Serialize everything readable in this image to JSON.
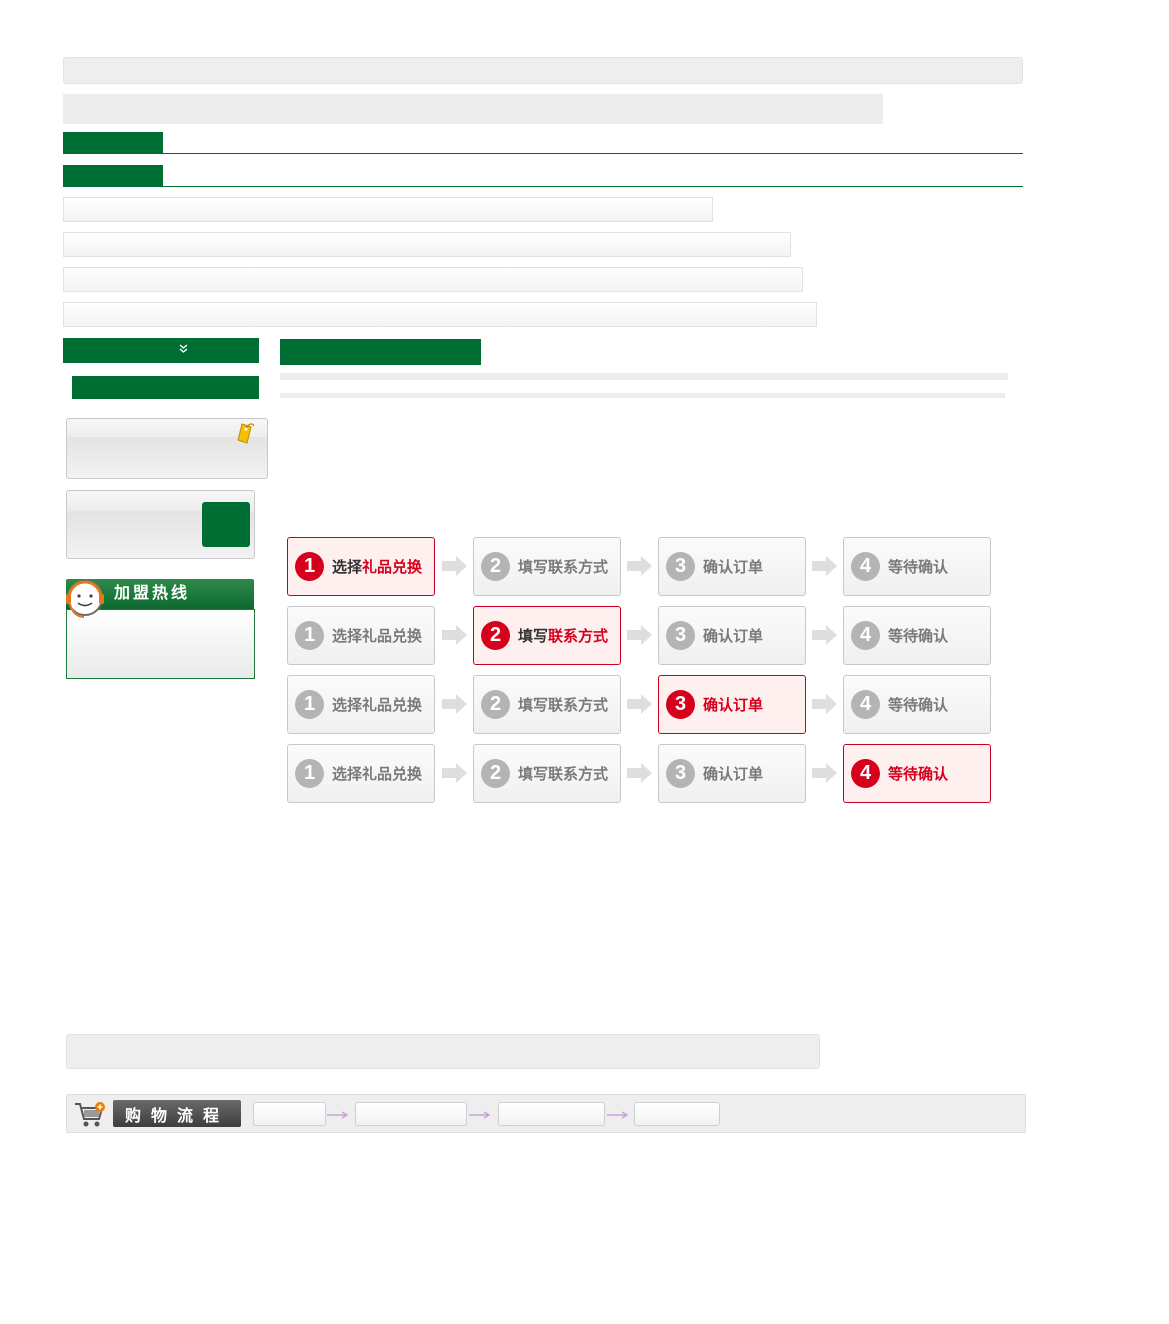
{
  "colors": {
    "brand_green": "#006e32",
    "active_red": "#d6001c",
    "inactive_gray": "#b4b4b4"
  },
  "sidebar": {
    "toggle_icon": "double-chevron-down-icon",
    "promo_icon": "price-tag-icon",
    "hotline_title": "加盟热线",
    "hotline_icon": "customer-service-headset-icon"
  },
  "steps": {
    "rows": [
      {
        "active": 1,
        "items": [
          {
            "num": "1",
            "pre": "选择",
            "hl": "礼品兑换"
          },
          {
            "num": "2",
            "pre": "填写联系方式",
            "hl": ""
          },
          {
            "num": "3",
            "pre": "确认订单",
            "hl": ""
          },
          {
            "num": "4",
            "pre": "等待确认",
            "hl": ""
          }
        ]
      },
      {
        "active": 2,
        "items": [
          {
            "num": "1",
            "pre": "选择礼品兑换",
            "hl": ""
          },
          {
            "num": "2",
            "pre": "填写",
            "hl": "联系方式"
          },
          {
            "num": "3",
            "pre": "确认订单",
            "hl": ""
          },
          {
            "num": "4",
            "pre": "等待确认",
            "hl": ""
          }
        ]
      },
      {
        "active": 3,
        "items": [
          {
            "num": "1",
            "pre": "选择礼品兑换",
            "hl": ""
          },
          {
            "num": "2",
            "pre": "填写联系方式",
            "hl": ""
          },
          {
            "num": "3",
            "pre": "",
            "hl": "确认订单"
          },
          {
            "num": "4",
            "pre": "等待确认",
            "hl": ""
          }
        ]
      },
      {
        "active": 4,
        "items": [
          {
            "num": "1",
            "pre": "选择礼品兑换",
            "hl": ""
          },
          {
            "num": "2",
            "pre": "填写联系方式",
            "hl": ""
          },
          {
            "num": "3",
            "pre": "确认订单",
            "hl": ""
          },
          {
            "num": "4",
            "pre": "",
            "hl": "等待确认"
          }
        ]
      }
    ]
  },
  "shopping_flow": {
    "title": "购物流程",
    "icon": "shopping-cart-add-icon"
  }
}
